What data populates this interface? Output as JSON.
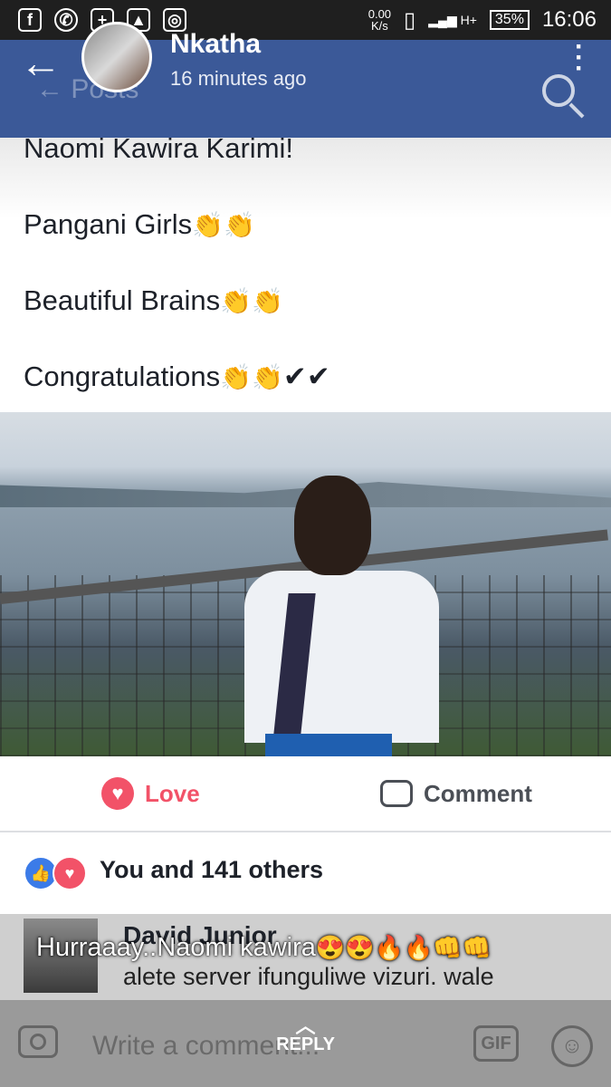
{
  "status_bar": {
    "net_speed": "0.00",
    "net_unit": "K/s",
    "signal": "H+",
    "battery": "35%",
    "time": "16:06"
  },
  "header": {
    "name": "Nkatha",
    "time_ago": "16 minutes ago",
    "ghost_title": "Posts",
    "colors": {
      "bar": "#3b5998"
    }
  },
  "post": {
    "lines": [
      "Naomi Kawira Karimi!",
      "Pangani Girls",
      "Beautiful Brains",
      "Congratulations"
    ],
    "clap_emoji": "👏👏",
    "checks": "✔✔"
  },
  "actions": {
    "love_label": "Love",
    "comment_label": "Comment",
    "love_color": "#f25268"
  },
  "reactions": {
    "summary": "You and 141 others",
    "icons": [
      "like-icon",
      "love-icon"
    ]
  },
  "comment": {
    "author": "David Junior",
    "text": "alete server ifunguliwe vizuri. wale",
    "overlay_text": "Hurraaay..Naomi kawira",
    "overlay_emoji": "😍😍🔥🔥👊👊"
  },
  "composer": {
    "placeholder": "Write a comment...",
    "gif_label": "GIF",
    "reply_label": "REPLY"
  }
}
